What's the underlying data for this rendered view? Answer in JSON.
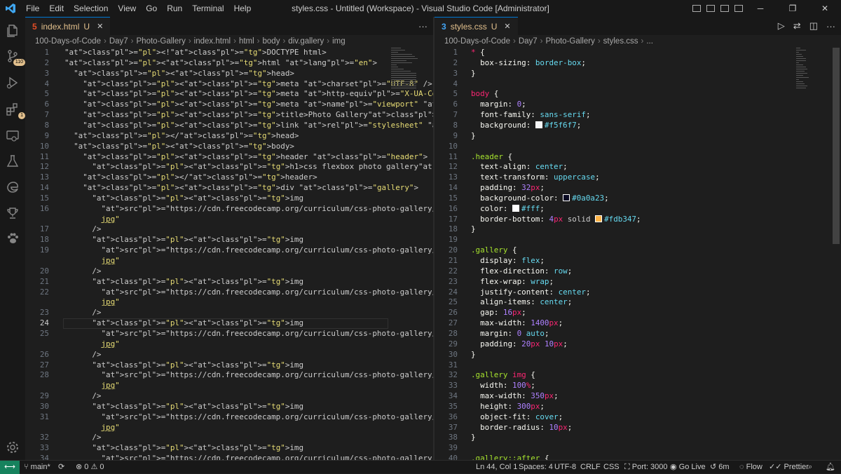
{
  "titlebar": {
    "menu": [
      "File",
      "Edit",
      "Selection",
      "View",
      "Go",
      "Run",
      "Terminal",
      "Help"
    ],
    "title": "styles.css - Untitled (Workspace) - Visual Studio Code [Administrator]",
    "win_controls": [
      "─",
      "❐",
      "✕"
    ]
  },
  "activity": {
    "icons": [
      "files-icon",
      "source-control-icon",
      "run-debug-icon",
      "extensions-icon",
      "remote-explorer-icon",
      "testing-icon",
      "edge-icon",
      "trophy-icon",
      "paw-icon"
    ],
    "source_control_badge": "110",
    "extensions_badge": "1",
    "bottom_icon": "settings-gear-icon"
  },
  "left_editor": {
    "tab": {
      "label": "index.html",
      "mod": "U",
      "close": "✕"
    },
    "more": "···",
    "breadcrumb": [
      "100-Days-of-Code",
      "Day7",
      "Photo-Gallery",
      "index.html",
      "html",
      "body",
      "div.gallery",
      "img"
    ],
    "cursor_line": 24,
    "lines": [
      {
        "n": "1",
        "t": "<!DOCTYPE html>"
      },
      {
        "n": "2",
        "t": "<html lang=\"en\">"
      },
      {
        "n": "3",
        "t": "  <head>"
      },
      {
        "n": "4",
        "t": "    <meta charset=\"UTF-8\" />"
      },
      {
        "n": "5",
        "t": "    <meta http-equiv=\"X-UA-Compatible\" content=\"IE=edge\" />"
      },
      {
        "n": "6",
        "t": "    <meta name=\"viewport\" content=\"width=device-width, initial-scale=1.0\" />"
      },
      {
        "n": "7",
        "t": "    <title>Photo Gallery</title>"
      },
      {
        "n": "8",
        "t": "    <link rel=\"stylesheet\" href=\"./styles.css\" />"
      },
      {
        "n": "9",
        "t": "  </head>"
      },
      {
        "n": "10",
        "t": "  <body>"
      },
      {
        "n": "11",
        "t": "    <header class=\"header\">"
      },
      {
        "n": "12",
        "t": "      <h1>css flexbox photo gallery</h1>"
      },
      {
        "n": "13",
        "t": "    </header>"
      },
      {
        "n": "14",
        "t": "    <div class=\"gallery\">"
      },
      {
        "n": "15",
        "t": "      <img"
      },
      {
        "n": "16",
        "t": "        src=\"https://cdn.freecodecamp.org/curriculum/css-photo-gallery/1."
      },
      {
        "n": "",
        "t": "        jpg\""
      },
      {
        "n": "17",
        "t": "      />"
      },
      {
        "n": "18",
        "t": "      <img"
      },
      {
        "n": "19",
        "t": "        src=\"https://cdn.freecodecamp.org/curriculum/css-photo-gallery/2."
      },
      {
        "n": "",
        "t": "        jpg\""
      },
      {
        "n": "20",
        "t": "      />"
      },
      {
        "n": "21",
        "t": "      <img"
      },
      {
        "n": "22",
        "t": "        src=\"https://cdn.freecodecamp.org/curriculum/css-photo-gallery/3."
      },
      {
        "n": "",
        "t": "        jpg\""
      },
      {
        "n": "23",
        "t": "      />"
      },
      {
        "n": "24",
        "t": "      <img"
      },
      {
        "n": "25",
        "t": "        src=\"https://cdn.freecodecamp.org/curriculum/css-photo-gallery/4."
      },
      {
        "n": "",
        "t": "        jpg\""
      },
      {
        "n": "26",
        "t": "      />"
      },
      {
        "n": "27",
        "t": "      <img"
      },
      {
        "n": "28",
        "t": "        src=\"https://cdn.freecodecamp.org/curriculum/css-photo-gallery/5."
      },
      {
        "n": "",
        "t": "        jpg\""
      },
      {
        "n": "29",
        "t": "      />"
      },
      {
        "n": "30",
        "t": "      <img"
      },
      {
        "n": "31",
        "t": "        src=\"https://cdn.freecodecamp.org/curriculum/css-photo-gallery/6."
      },
      {
        "n": "",
        "t": "        jpg\""
      },
      {
        "n": "32",
        "t": "      />"
      },
      {
        "n": "33",
        "t": "      <img"
      },
      {
        "n": "34",
        "t": "        src=\"https://cdn.freecodecamp.org/curriculum/css-photo-gallery/7."
      }
    ]
  },
  "right_editor": {
    "tab": {
      "label": "styles.css",
      "mod": "U",
      "close": "✕"
    },
    "breadcrumb": [
      "100-Days-of-Code",
      "Day7",
      "Photo-Gallery",
      "styles.css",
      "..."
    ],
    "lines": [
      {
        "n": "1",
        "t": "* {"
      },
      {
        "n": "2",
        "t": "  box-sizing: border-box;"
      },
      {
        "n": "3",
        "t": "}"
      },
      {
        "n": "4",
        "t": ""
      },
      {
        "n": "5",
        "t": "body {"
      },
      {
        "n": "6",
        "t": "  margin: 0;"
      },
      {
        "n": "7",
        "t": "  font-family: sans-serif;"
      },
      {
        "n": "8",
        "t": "  background: #f5f6f7;",
        "sw": "#f5f6f7"
      },
      {
        "n": "9",
        "t": "}"
      },
      {
        "n": "10",
        "t": ""
      },
      {
        "n": "11",
        "t": ".header {"
      },
      {
        "n": "12",
        "t": "  text-align: center;"
      },
      {
        "n": "13",
        "t": "  text-transform: uppercase;"
      },
      {
        "n": "14",
        "t": "  padding: 32px;"
      },
      {
        "n": "15",
        "t": "  background-color: #0a0a23;",
        "sw": "#0a0a23"
      },
      {
        "n": "16",
        "t": "  color: #fff;",
        "sw": "#ffffff"
      },
      {
        "n": "17",
        "t": "  border-bottom: 4px solid #fdb347;",
        "sw": "#fdb347"
      },
      {
        "n": "18",
        "t": "}"
      },
      {
        "n": "19",
        "t": ""
      },
      {
        "n": "20",
        "t": ".gallery {"
      },
      {
        "n": "21",
        "t": "  display: flex;"
      },
      {
        "n": "22",
        "t": "  flex-direction: row;"
      },
      {
        "n": "23",
        "t": "  flex-wrap: wrap;"
      },
      {
        "n": "24",
        "t": "  justify-content: center;"
      },
      {
        "n": "25",
        "t": "  align-items: center;"
      },
      {
        "n": "26",
        "t": "  gap: 16px;"
      },
      {
        "n": "27",
        "t": "  max-width: 1400px;"
      },
      {
        "n": "28",
        "t": "  margin: 0 auto;"
      },
      {
        "n": "29",
        "t": "  padding: 20px 10px;"
      },
      {
        "n": "30",
        "t": "}"
      },
      {
        "n": "31",
        "t": ""
      },
      {
        "n": "32",
        "t": ".gallery img {"
      },
      {
        "n": "33",
        "t": "  width: 100%;"
      },
      {
        "n": "34",
        "t": "  max-width: 350px;"
      },
      {
        "n": "35",
        "t": "  height: 300px;"
      },
      {
        "n": "36",
        "t": "  object-fit: cover;"
      },
      {
        "n": "37",
        "t": "  border-radius: 10px;"
      },
      {
        "n": "38",
        "t": "}"
      },
      {
        "n": "39",
        "t": ""
      },
      {
        "n": "40",
        "t": ".gallery::after {"
      }
    ]
  },
  "statusbar": {
    "remote": "⟷",
    "branch": "main*",
    "sync": "⟳",
    "problems": "⊗ 0 ⚠ 0",
    "position": "Ln 44, Col 1",
    "spaces": "Spaces: 4",
    "encoding": "UTF-8",
    "eol": "CRLF",
    "language": "CSS",
    "port": "Port: 3000",
    "golive": "Go Live",
    "time": "6m",
    "flow": "Flow",
    "prettier": "Prettier"
  },
  "colors": {
    "accent": "#0078d4",
    "remote_bg": "#16825d",
    "modified": "#e2c08d"
  }
}
